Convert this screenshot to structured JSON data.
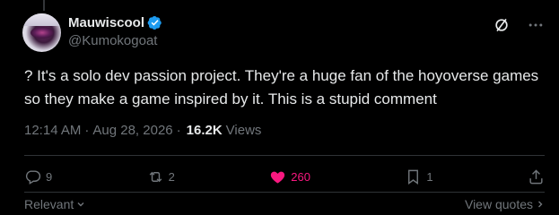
{
  "post": {
    "author": {
      "display_name": "Mauwiscool",
      "handle": "@Kumokogoat",
      "verified": true
    },
    "text": "? It's a solo dev passion project. They're a huge fan of the hoyoverse games so they make a game inspired by it. This is a stupid comment",
    "time": "12:14 AM",
    "separator": "·",
    "date": "Aug 28, 2026",
    "views_count": "16.2K",
    "views_label": "Views"
  },
  "actions": {
    "replies": "9",
    "reposts": "2",
    "likes": "260",
    "bookmarks": "1"
  },
  "footer": {
    "sort_label": "Relevant",
    "quotes_label": "View quotes"
  },
  "colors": {
    "background": "#000000",
    "text": "#e7e9ea",
    "muted": "#71767b",
    "like": "#f91880",
    "verified": "#1d9bf0"
  }
}
